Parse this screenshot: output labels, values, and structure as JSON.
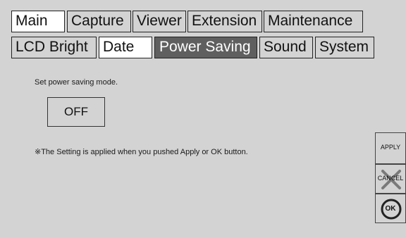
{
  "tabs_row1": [
    {
      "label": "Main"
    },
    {
      "label": "Capture"
    },
    {
      "label": "Viewer"
    },
    {
      "label": "Extension"
    },
    {
      "label": "Maintenance"
    }
  ],
  "tabs_row2": [
    {
      "label": "LCD Bright"
    },
    {
      "label": "Date"
    },
    {
      "label": "Power Saving"
    },
    {
      "label": "Sound"
    },
    {
      "label": "System"
    }
  ],
  "panel": {
    "instruction": "Set power saving mode.",
    "mode_value": "OFF",
    "note": "※The Setting is applied when you pushed Apply or OK button."
  },
  "side_buttons": {
    "apply_label": "APPLY",
    "cancel_label": "CANCEL",
    "ok_label": "OK"
  },
  "colors": {
    "background": "#d3d3d3",
    "active_tab": "#5f5f5f",
    "light_tab": "#ffffff"
  }
}
